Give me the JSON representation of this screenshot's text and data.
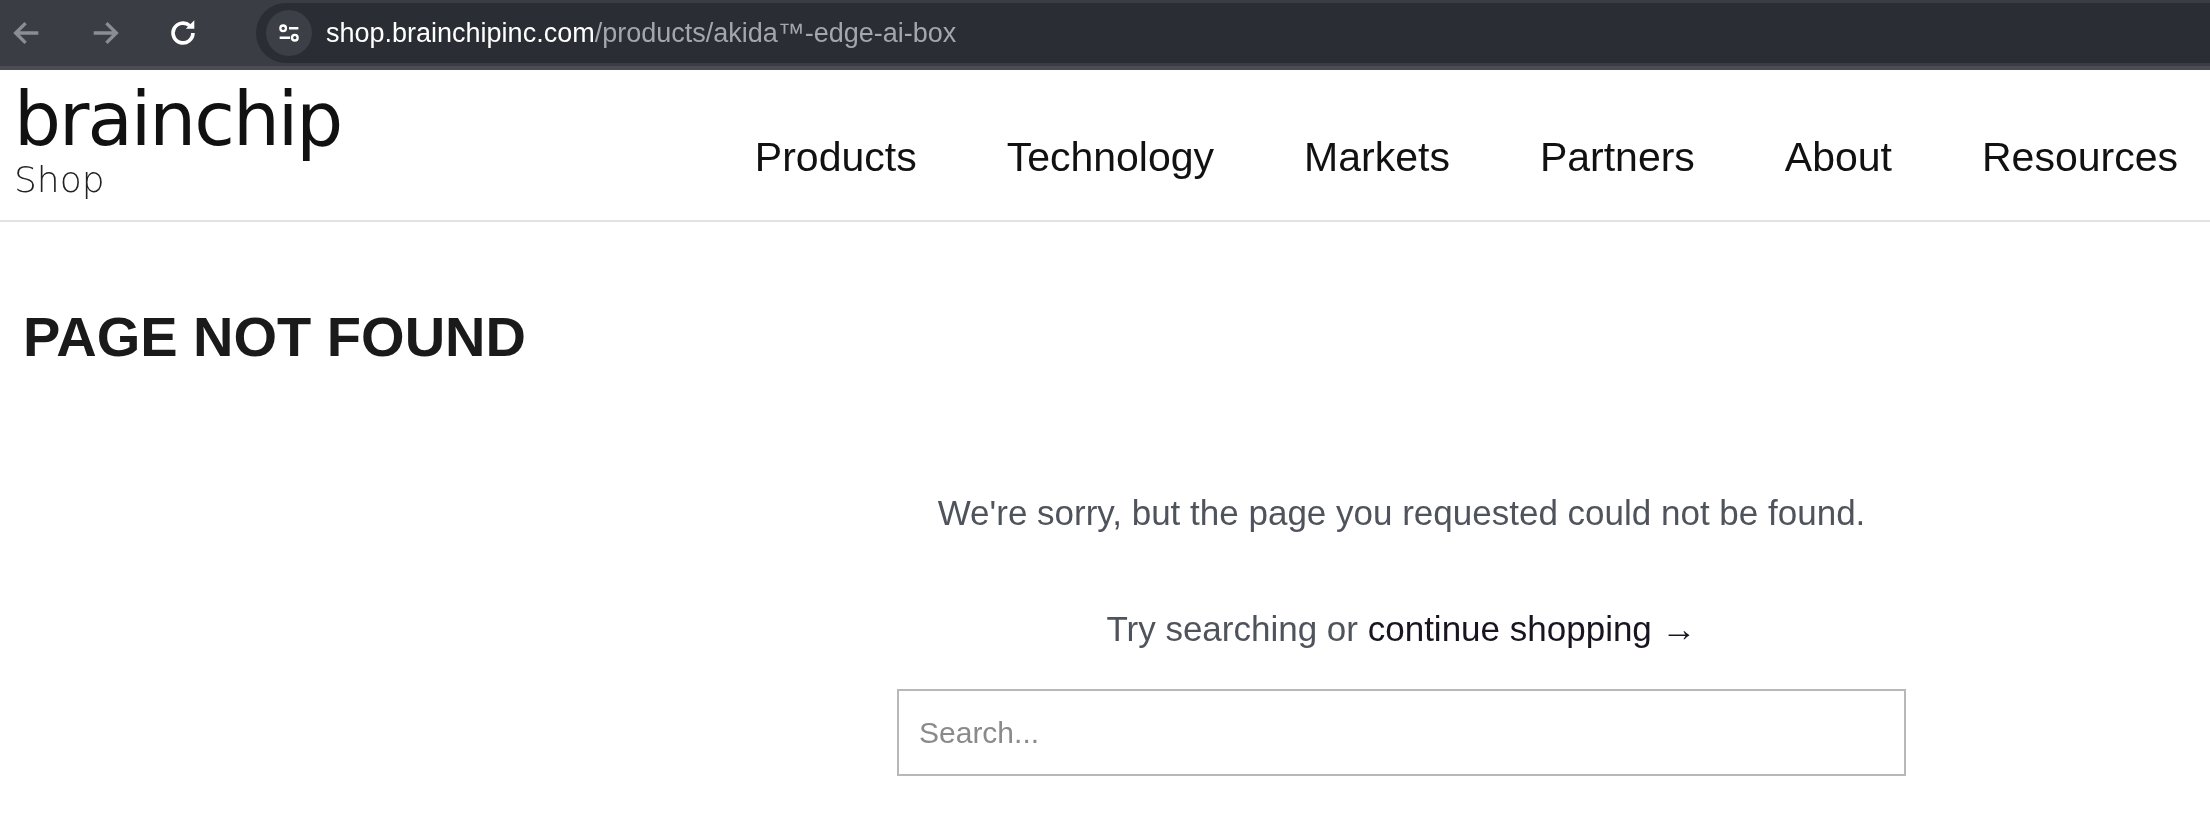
{
  "browser": {
    "url_host": "shop.brainchipinc.com",
    "url_path": "/products/akida™-edge-ai-box"
  },
  "header": {
    "logo": {
      "name": "brainchip",
      "sub": "Shop"
    },
    "nav": [
      "Products",
      "Technology",
      "Markets",
      "Partners",
      "About",
      "Resources"
    ]
  },
  "page": {
    "title": "PAGE NOT FOUND",
    "message": "We're sorry, but the page you requested could not be found.",
    "hint_prefix": "Try searching or",
    "hint_link": "continue shopping →",
    "search": {
      "placeholder": "Search..."
    }
  }
}
